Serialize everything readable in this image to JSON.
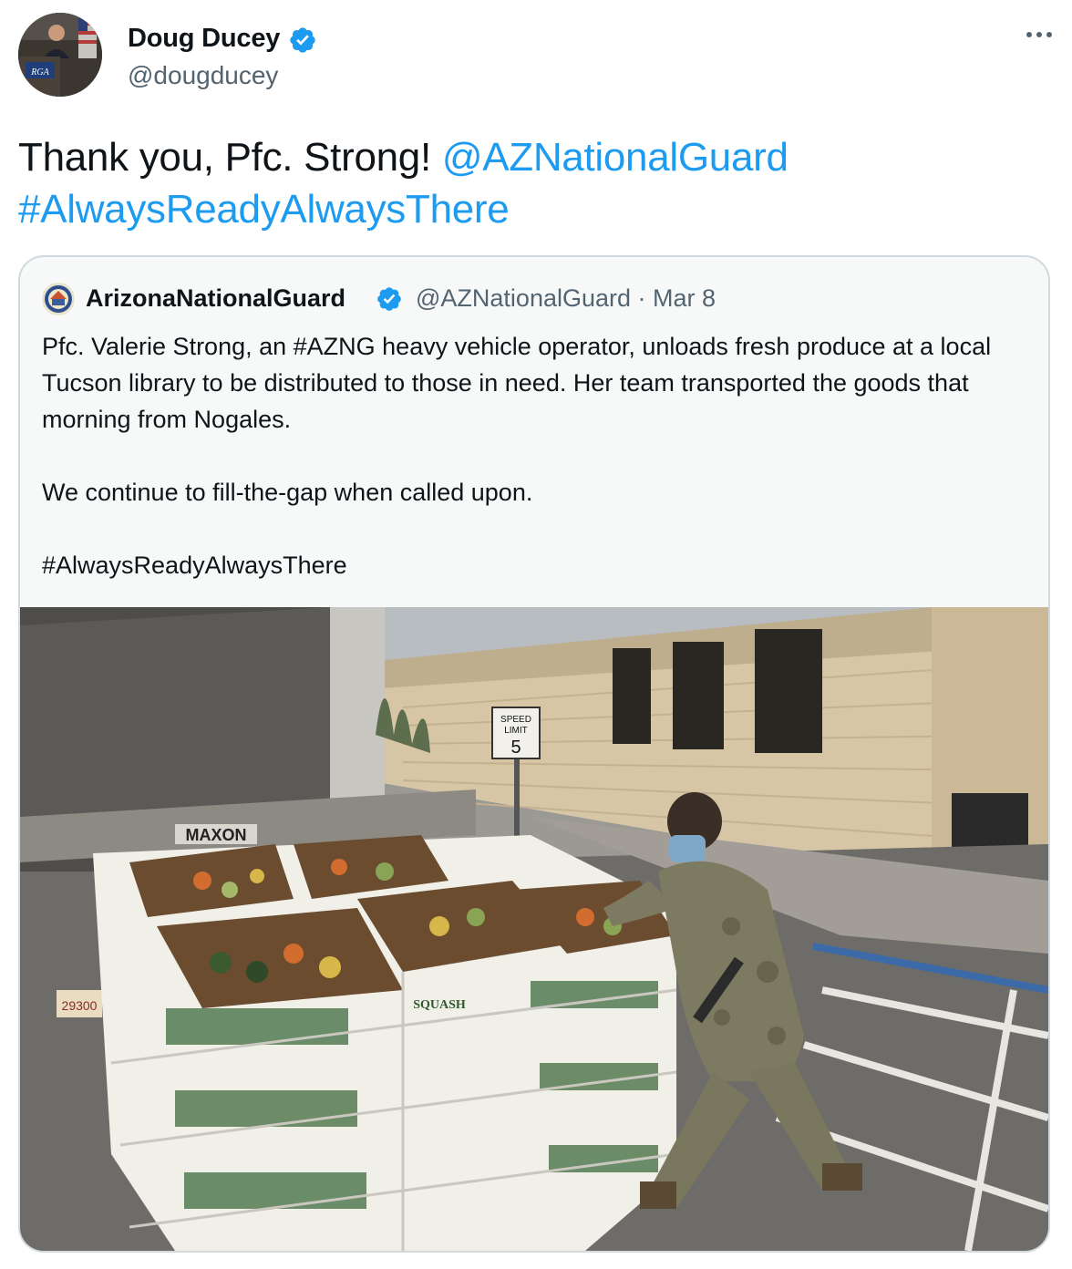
{
  "author": {
    "name": "Doug Ducey",
    "handle": "@dougducey",
    "avatar_podium_text": "RGA"
  },
  "icons": {
    "verified": "verified-badge-icon",
    "more": "more-options-icon"
  },
  "tweet": {
    "text_plain": "Thank you, Pfc. Strong!",
    "mention": "@AZNationalGuard",
    "hashtag": "#AlwaysReadyAlwaysThere"
  },
  "quoted": {
    "name": "ArizonaNationalGuard",
    "handle": "@AZNationalGuard",
    "separator": "·",
    "date": "Mar 8",
    "text": "Pfc. Valerie Strong, an #AZNG heavy vehicle operator, unloads fresh produce at a local Tucson library to be distributed to those in need. Her team transported the goods that morning from Nogales.\n\nWe continue to fill-the-gap when called upon.\n\n#AlwaysReadyAlwaysThere",
    "photo": {
      "truck_brand": "MAXON",
      "speed_sign_top": "SPEED",
      "speed_sign_mid": "LIMIT",
      "speed_limit": "5",
      "box_label": "SQUASH",
      "truck_plate": "29300"
    }
  },
  "colors": {
    "link": "#1d9bf0",
    "verified": "#1d9bf0",
    "secondary_text": "#536471",
    "card_border": "#cfd9de",
    "card_bg": "#f7f9f9"
  }
}
